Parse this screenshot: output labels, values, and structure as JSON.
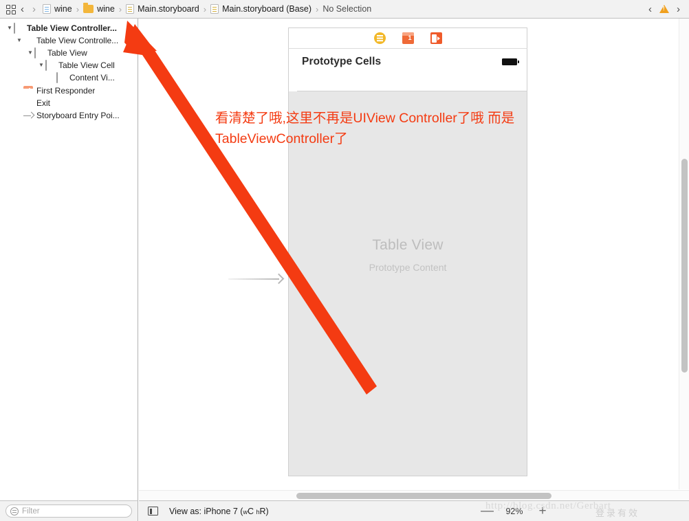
{
  "jumpbar": {
    "grid_icon": "grid-icon",
    "back_arrow": "chevron-left",
    "forward_arrow": "chevron-right",
    "breadcrumbs": [
      {
        "label": "wine",
        "icon": "project-file-icon"
      },
      {
        "label": "wine",
        "icon": "folder-icon"
      },
      {
        "label": "Main.storyboard",
        "icon": "storyboard-file-icon"
      },
      {
        "label": "Main.storyboard (Base)",
        "icon": "storyboard-file-icon"
      },
      {
        "label": "No Selection",
        "icon": "none"
      }
    ],
    "separator": "›",
    "issue_prev": "‹",
    "issue_next": "›",
    "warning_icon": "warning-triangle-icon"
  },
  "outline": {
    "items": [
      {
        "label": "Table View Controller...",
        "icon": "scene-icon",
        "indent": 0,
        "expanded": true,
        "bold": true,
        "has_disclosure": true
      },
      {
        "label": "Table View Controlle...",
        "icon": "view-controller-icon",
        "indent": 1,
        "expanded": true,
        "bold": false,
        "has_disclosure": true
      },
      {
        "label": "Table View",
        "icon": "table-view-icon",
        "indent": 2,
        "expanded": true,
        "bold": false,
        "has_disclosure": true
      },
      {
        "label": "Table View Cell",
        "icon": "table-view-cell-icon",
        "indent": 3,
        "expanded": true,
        "bold": false,
        "has_disclosure": true
      },
      {
        "label": "Content Vi...",
        "icon": "content-view-icon",
        "indent": 4,
        "expanded": false,
        "bold": false,
        "has_disclosure": false
      },
      {
        "label": "First Responder",
        "icon": "first-responder-icon",
        "indent": 1,
        "expanded": false,
        "bold": false,
        "has_disclosure": false
      },
      {
        "label": "Exit",
        "icon": "exit-icon",
        "indent": 1,
        "expanded": false,
        "bold": false,
        "has_disclosure": false
      },
      {
        "label": "Storyboard Entry Poi...",
        "icon": "entry-point-icon",
        "indent": 1,
        "expanded": false,
        "bold": false,
        "has_disclosure": false
      }
    ],
    "disclosure_open": "▼",
    "filter": {
      "placeholder": "Filter",
      "value": "",
      "icon": "filter-icon"
    }
  },
  "canvas": {
    "scene": {
      "dock_icons": [
        {
          "name": "view-controller-dock-icon"
        },
        {
          "name": "first-responder-dock-icon"
        },
        {
          "name": "exit-dock-icon"
        }
      ],
      "prototype_cells_title": "Prototype Cells",
      "battery_icon": "battery-icon",
      "table_view_label": "Table View",
      "table_view_sublabel": "Prototype Content",
      "entry_point_arrow": "storyboard-entry-point-arrow"
    },
    "annotation": {
      "line1": "看清楚了哦,这里不再是UIView Controller了哦 而是",
      "line2": "TableViewController了",
      "color": "#f43b12",
      "arrow": "red-annotation-arrow"
    }
  },
  "bottombar": {
    "view_as_icon": "device-preview-icon",
    "view_as_prefix": "View as: iPhone 7 (",
    "trait_w": "w",
    "trait_wc": "C ",
    "trait_h": "h",
    "trait_hr": "R)",
    "zoom_out": "—",
    "zoom_level": "92%",
    "zoom_in": "+"
  },
  "watermark": {
    "url": "http://blog.csdn.net/Gerbart",
    "cjk": "登录有效"
  },
  "scrollbars": {
    "vertical": "canvas-vertical-scrollbar",
    "horizontal": "canvas-horizontal-scrollbar"
  }
}
